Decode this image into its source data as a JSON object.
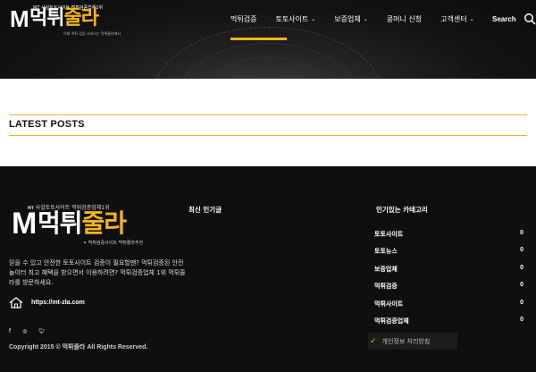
{
  "header": {
    "logo": {
      "tagline": "MT 사설토토사이트 먹튀검증업체1위",
      "letter": "M",
      "name_white": "먹튀",
      "name_yellow": "줄라",
      "sub": "이제 먹튀 검증 서비스는 먹튀줄라에서"
    },
    "nav": [
      {
        "label": "먹튀검증",
        "has_dropdown": false
      },
      {
        "label": "토토사이트",
        "has_dropdown": true
      },
      {
        "label": "보증업체",
        "has_dropdown": true
      },
      {
        "label": "콩머니 신청",
        "has_dropdown": false
      },
      {
        "label": "고객센터",
        "has_dropdown": true
      }
    ],
    "search_label": "Search",
    "accent_color": "#f2b51a"
  },
  "main": {
    "latest_posts_title": "LATEST POSTS"
  },
  "footer": {
    "logo": {
      "tag_prefix": "MT",
      "tagline": "사설토토사이트 먹튀검증업체1위",
      "letter": "M",
      "name_white": "먹튀",
      "name_yellow": "줄라",
      "sub": "먹튀검증사이트 먹튀줄라추천"
    },
    "description": "믿을 수 있고 안전한 토토사이트 검증이 필요할땐? 먹튀검증된 안전놀이터 최고 혜택을 받으면서 이용하려면? 먹튀검증업체 1위 먹튀줄라를 방문하세요.",
    "site_url": "https://mt-zla.com",
    "social": [
      "f",
      "ig",
      "tw"
    ],
    "copyright": "Copyright 2015 © 먹튀줄라 All Rights Reserved.",
    "recent_title": "최신 인기글",
    "categories_title": "인기있는 카테고리",
    "categories": [
      {
        "name": "토토사이트",
        "count": "0"
      },
      {
        "name": "토토뉴스",
        "count": "0"
      },
      {
        "name": "보증업체",
        "count": "0"
      },
      {
        "name": "먹튀검증",
        "count": "0"
      },
      {
        "name": "먹튀사이트",
        "count": "0"
      },
      {
        "name": "먹튀검증업체",
        "count": "0"
      }
    ],
    "privacy_label": "개인정보 처리방침"
  }
}
